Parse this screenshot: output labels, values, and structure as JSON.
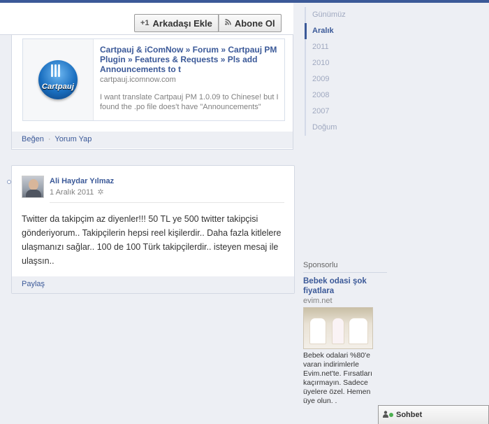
{
  "header": {
    "add_friend_label": "Arkadaşı Ekle",
    "add_friend_icon": "+1",
    "subscribe_label": "Abone Ol",
    "subscribe_icon": "rss"
  },
  "shared_link_post": {
    "link_title": "Cartpauj & iComNow » Forum » Cartpauj PM Plugin » Features & Requests » Pls add Announcements to t",
    "link_domain": "cartpauj.icomnow.com",
    "link_description": "I want translate Cartpauj PM 1.0.09 to Chinese! but I found the .po file does't have \"Announcements\"",
    "logo_text": "Cartpauj",
    "like_label": "Beğen",
    "separator": "·",
    "comment_label": "Yorum Yap"
  },
  "status_post": {
    "author": "Ali Haydar Yılmaz",
    "date": "1 Aralık 2011",
    "body": "Twitter da takipçim az diyenler!!! 50 TL ye 500 twitter takipçisi gönderiyorum.. Takipçilerin hepsi reel kişilerdir.. Daha fazla kitlelere ulaşmanızı sağlar.. 100 de 100 Türk takipçilerdir.. isteyen mesaj ile ulaşsın..",
    "share_label": "Paylaş"
  },
  "timeline_nav": {
    "items": [
      {
        "label": "Günümüz",
        "active": false
      },
      {
        "label": "Aralık",
        "active": true
      },
      {
        "label": "2011",
        "active": false
      },
      {
        "label": "2010",
        "active": false
      },
      {
        "label": "2009",
        "active": false
      },
      {
        "label": "2008",
        "active": false
      },
      {
        "label": "2007",
        "active": false
      },
      {
        "label": "Doğum",
        "active": false
      }
    ]
  },
  "sponsored": {
    "label": "Sponsorlu",
    "ad_title": "Bebek odasi şok fiyatlara",
    "ad_domain": "evim.net",
    "ad_description": "Bebek odalari %80'e varan indirimlerle Evim.net'te. Fırsatları kaçırmayın. Sadece üyelere özel. Hemen üye olun. ."
  },
  "chat": {
    "label": "Sohbet"
  },
  "colors": {
    "brand_blue": "#3b5998",
    "page_background": "#edeff4",
    "muted_text": "#808080"
  }
}
